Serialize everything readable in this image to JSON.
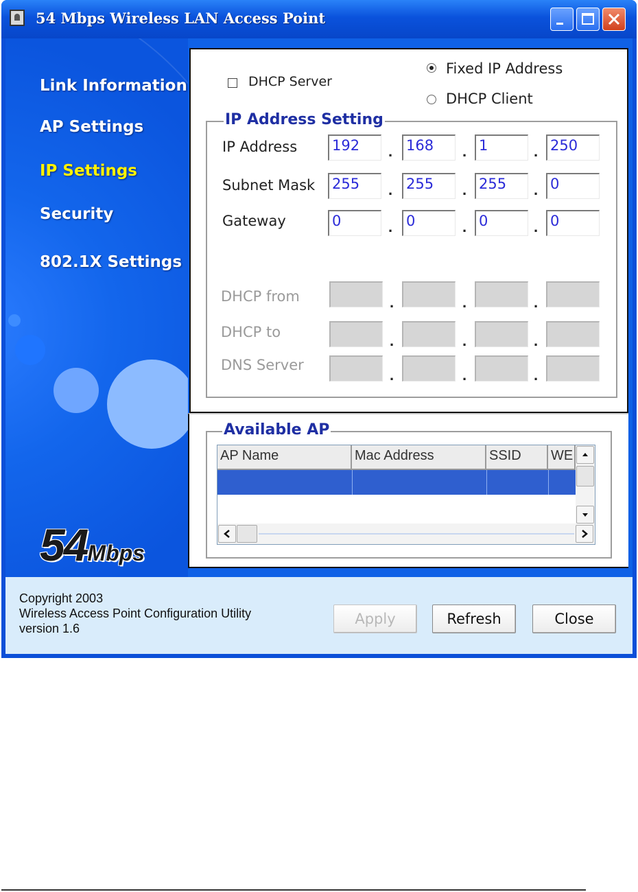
{
  "window": {
    "title": "54 Mbps Wireless LAN Access Point"
  },
  "nav": {
    "items": [
      {
        "label": "Link Information",
        "active": false
      },
      {
        "label": "AP Settings",
        "active": false
      },
      {
        "label": "IP Settings",
        "active": true
      },
      {
        "label": "Security",
        "active": false
      },
      {
        "label": "802.1X Settings",
        "active": false
      }
    ]
  },
  "logo": {
    "big": "54",
    "small": "Mbps"
  },
  "ip_settings": {
    "dhcp_server": {
      "label": "DHCP Server",
      "checked": false
    },
    "mode": {
      "fixed_label": "Fixed IP Address",
      "client_label": "DHCP Client",
      "selected": "Fixed IP Address"
    },
    "group_title": "IP Address Setting",
    "rows": [
      {
        "label": "IP Address",
        "octets": [
          "192",
          "168",
          "1",
          "250"
        ],
        "enabled": true
      },
      {
        "label": "Subnet Mask",
        "octets": [
          "255",
          "255",
          "255",
          "0"
        ],
        "enabled": true
      },
      {
        "label": "Gateway",
        "octets": [
          "0",
          "0",
          "0",
          "0"
        ],
        "enabled": true
      },
      {
        "label": "DHCP from",
        "octets": [
          "",
          "",
          "",
          ""
        ],
        "enabled": false
      },
      {
        "label": "DHCP to",
        "octets": [
          "",
          "",
          "",
          ""
        ],
        "enabled": false
      },
      {
        "label": "DNS Server",
        "octets": [
          "",
          "",
          "",
          ""
        ],
        "enabled": false
      }
    ],
    "separator": "."
  },
  "available_ap": {
    "title": "Available AP",
    "columns": [
      "AP Name",
      "Mac Address",
      "SSID",
      "WEI"
    ],
    "rows": [
      [
        "",
        "",
        "",
        ""
      ]
    ]
  },
  "footer": {
    "copyright": "Copyright 2003",
    "product": "Wireless Access Point Configuration Utility",
    "version": "version 1.6"
  },
  "buttons": {
    "apply": "Apply",
    "refresh": "Refresh",
    "close": "Close"
  },
  "colors": {
    "title_bar": "#0a52dc",
    "nav_active": "#fff200",
    "group_title": "#1f2fa3",
    "ip_value": "#2b2bd8",
    "selection": "#2f5fcf"
  }
}
